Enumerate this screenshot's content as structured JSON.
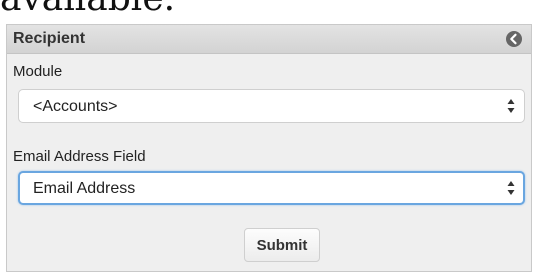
{
  "document": {
    "heading_fragment": "available."
  },
  "panel": {
    "title": "Recipient",
    "collapse_icon": "circle-arrow-left-icon",
    "module": {
      "label": "Module",
      "selected": "<Accounts>"
    },
    "email_field": {
      "label": "Email Address Field",
      "selected": "Email Address"
    },
    "submit_label": "Submit"
  },
  "colors": {
    "focus_border": "#6aa6e0",
    "header_bg": "#d9d9d9",
    "panel_bg": "#efefef"
  }
}
